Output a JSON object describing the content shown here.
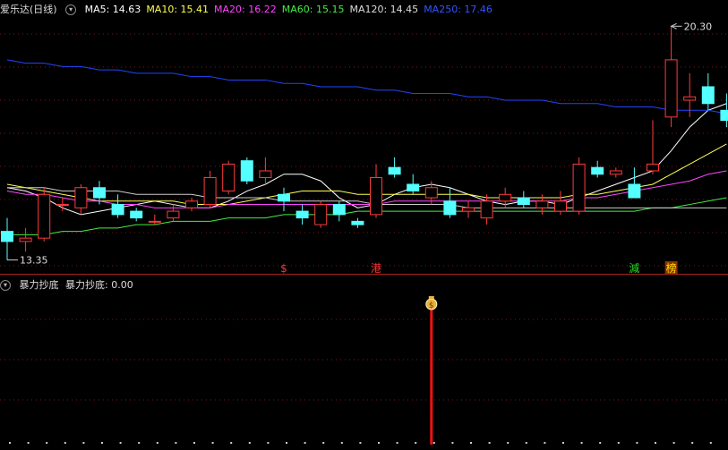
{
  "header": {
    "title": "爱乐达(日线)",
    "ma": [
      {
        "label": "MA5: 14.63",
        "color": "#ffffff"
      },
      {
        "label": "MA10: 15.41",
        "color": "#ffff55"
      },
      {
        "label": "MA20: 16.22",
        "color": "#ff44ff"
      },
      {
        "label": "MA60: 15.15",
        "color": "#44ee44"
      },
      {
        "label": "MA120: 14.45",
        "color": "#dddddd"
      },
      {
        "label": "MA250: 17.46",
        "color": "#3355ff"
      }
    ]
  },
  "price_labels": {
    "high": "20.30",
    "low": "13.35"
  },
  "markers": [
    {
      "text": "$",
      "color": "#ff3333",
      "bg": "",
      "index": 15
    },
    {
      "text": "港",
      "color": "#ff3333",
      "bg": "",
      "index": 20
    },
    {
      "text": "減",
      "color": "#22dd22",
      "bg": "",
      "index": 34
    },
    {
      "text": "榜",
      "color": "#ffdd00",
      "bg": "#883300",
      "index": 36
    }
  ],
  "indicator": {
    "name": "暴力抄底",
    "value_label": "暴力抄底: 0.00",
    "signal_icon": "money-bag-icon",
    "signal_index": 23
  },
  "chart_data": {
    "type": "candlestick",
    "ohlc": [
      [
        14.2,
        14.6,
        13.35,
        13.9
      ],
      [
        13.9,
        14.3,
        13.6,
        14.0
      ],
      [
        14.0,
        15.5,
        13.9,
        15.3
      ],
      [
        15.0,
        15.2,
        14.8,
        15.0
      ],
      [
        14.9,
        15.6,
        14.7,
        15.5
      ],
      [
        15.5,
        15.7,
        15.0,
        15.2
      ],
      [
        15.0,
        15.3,
        14.6,
        14.7
      ],
      [
        14.8,
        14.9,
        14.5,
        14.6
      ],
      [
        14.5,
        14.7,
        14.4,
        14.5
      ],
      [
        14.6,
        15.0,
        14.5,
        14.8
      ],
      [
        14.9,
        15.2,
        14.8,
        15.1
      ],
      [
        15.0,
        16.0,
        14.9,
        15.8
      ],
      [
        15.4,
        16.3,
        15.3,
        16.2
      ],
      [
        16.3,
        16.4,
        15.6,
        15.7
      ],
      [
        15.8,
        16.4,
        15.6,
        16.0
      ],
      [
        15.3,
        15.5,
        14.8,
        15.1
      ],
      [
        14.8,
        15.0,
        14.4,
        14.6
      ],
      [
        14.4,
        15.1,
        14.3,
        15.0
      ],
      [
        15.0,
        15.1,
        14.5,
        14.7
      ],
      [
        14.5,
        14.6,
        14.3,
        14.4
      ],
      [
        14.7,
        16.2,
        14.6,
        15.8
      ],
      [
        16.1,
        16.4,
        15.8,
        15.9
      ],
      [
        15.6,
        15.9,
        15.3,
        15.4
      ],
      [
        15.2,
        15.7,
        15.0,
        15.5
      ],
      [
        15.1,
        15.5,
        14.6,
        14.7
      ],
      [
        14.8,
        15.1,
        14.6,
        14.9
      ],
      [
        14.6,
        15.3,
        14.4,
        15.1
      ],
      [
        15.1,
        15.5,
        14.9,
        15.3
      ],
      [
        15.2,
        15.4,
        14.9,
        15.0
      ],
      [
        14.9,
        15.3,
        14.7,
        15.1
      ],
      [
        14.8,
        15.4,
        14.7,
        15.1
      ],
      [
        14.8,
        16.4,
        14.7,
        16.2
      ],
      [
        16.1,
        16.3,
        15.8,
        15.9
      ],
      [
        15.9,
        16.1,
        15.8,
        16.0
      ],
      [
        15.6,
        16.1,
        15.2,
        15.2
      ],
      [
        16.0,
        17.5,
        15.9,
        16.2
      ],
      [
        17.6,
        20.3,
        17.3,
        19.3
      ],
      [
        18.1,
        18.9,
        17.6,
        18.2
      ],
      [
        18.5,
        18.9,
        17.8,
        18.0
      ],
      [
        17.8,
        18.3,
        17.3,
        17.5
      ]
    ],
    "ma_series": [
      {
        "name": "MA5",
        "color": "#ffffff",
        "values": [
          15.5,
          15.4,
          15.2,
          14.9,
          14.7,
          14.8,
          14.9,
          15.0,
          15.1,
          15.0,
          14.9,
          14.9,
          15.1,
          15.4,
          15.6,
          15.9,
          15.9,
          15.7,
          15.2,
          14.9,
          15.0,
          15.3,
          15.5,
          15.6,
          15.5,
          15.3,
          15.1,
          15.0,
          15.1,
          15.1,
          15.0,
          15.2,
          15.4,
          15.6,
          15.8,
          16.0,
          16.6,
          17.3,
          17.8,
          18.0
        ]
      },
      {
        "name": "MA10",
        "color": "#ffff55",
        "values": [
          15.6,
          15.5,
          15.4,
          15.3,
          15.2,
          15.1,
          15.1,
          15.1,
          15.1,
          15.1,
          15.0,
          15.0,
          15.0,
          15.1,
          15.2,
          15.3,
          15.4,
          15.4,
          15.4,
          15.3,
          15.3,
          15.3,
          15.3,
          15.3,
          15.3,
          15.3,
          15.2,
          15.2,
          15.2,
          15.2,
          15.2,
          15.3,
          15.3,
          15.4,
          15.5,
          15.6,
          15.9,
          16.2,
          16.5,
          16.8
        ]
      },
      {
        "name": "MA20",
        "color": "#ff44ff",
        "values": [
          15.4,
          15.3,
          15.3,
          15.2,
          15.1,
          15.1,
          15.0,
          15.0,
          14.9,
          14.9,
          14.9,
          14.9,
          15.0,
          15.0,
          15.0,
          15.0,
          15.0,
          15.0,
          15.0,
          15.0,
          15.0,
          15.1,
          15.1,
          15.1,
          15.1,
          15.1,
          15.1,
          15.1,
          15.1,
          15.1,
          15.1,
          15.2,
          15.2,
          15.3,
          15.4,
          15.5,
          15.6,
          15.7,
          15.9,
          16.0
        ]
      },
      {
        "name": "MA60",
        "color": "#44ee44",
        "values": [
          14.1,
          14.1,
          14.1,
          14.2,
          14.2,
          14.3,
          14.3,
          14.4,
          14.4,
          14.5,
          14.5,
          14.5,
          14.6,
          14.6,
          14.6,
          14.7,
          14.7,
          14.7,
          14.7,
          14.8,
          14.8,
          14.8,
          14.8,
          14.8,
          14.8,
          14.8,
          14.8,
          14.8,
          14.8,
          14.8,
          14.8,
          14.8,
          14.8,
          14.8,
          14.8,
          14.9,
          14.9,
          15.0,
          15.1,
          15.2
        ]
      },
      {
        "name": "MA120",
        "color": "#cccccc",
        "values": [
          15.5,
          15.5,
          15.5,
          15.4,
          15.4,
          15.4,
          15.4,
          15.3,
          15.3,
          15.3,
          15.3,
          15.2,
          15.2,
          15.2,
          15.2,
          15.1,
          15.1,
          15.1,
          15.1,
          15.1,
          15.0,
          15.0,
          15.0,
          15.0,
          15.0,
          14.9,
          14.9,
          14.9,
          14.9,
          14.9,
          14.9,
          14.9,
          14.9,
          14.9,
          14.9,
          14.9,
          14.9,
          14.9,
          14.9,
          14.9
        ]
      },
      {
        "name": "MA250",
        "color": "#2244ff",
        "values": [
          19.3,
          19.2,
          19.2,
          19.1,
          19.1,
          19.0,
          19.0,
          18.9,
          18.9,
          18.9,
          18.8,
          18.8,
          18.7,
          18.7,
          18.7,
          18.6,
          18.6,
          18.5,
          18.5,
          18.5,
          18.4,
          18.4,
          18.3,
          18.3,
          18.3,
          18.2,
          18.2,
          18.1,
          18.1,
          18.1,
          18.0,
          18.0,
          18.0,
          17.9,
          17.9,
          17.9,
          17.8,
          17.8,
          17.8,
          17.7
        ]
      }
    ],
    "ylim": [
      13.1,
      20.6
    ]
  }
}
